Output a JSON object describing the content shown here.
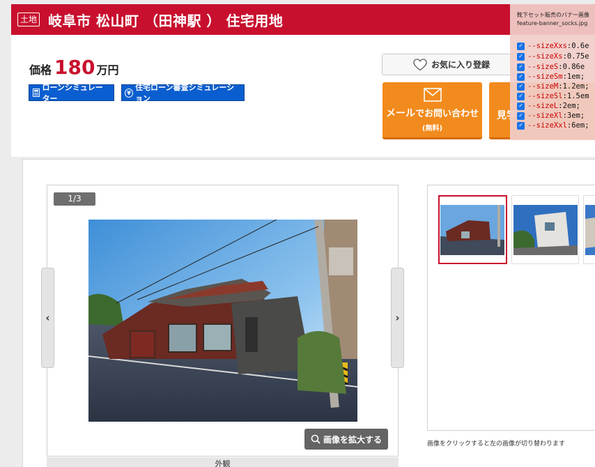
{
  "header": {
    "category_badge": "土地",
    "title": "岐阜市 松山町 （田神駅 ） 住宅用地"
  },
  "price": {
    "label": "価格",
    "value": "180",
    "unit": "万円"
  },
  "simulators": {
    "loan": "ローンシミュレーター",
    "review": "住宅ローン審査シミュレーション"
  },
  "actions": {
    "favorite": "お気に入り登録",
    "mail_big": "メール",
    "mail_rest": "でお問い合わせ",
    "mail_sub": "(無料)",
    "visit_partial": "見学"
  },
  "gallery": {
    "counter": "1/3",
    "prev_arrow": "‹",
    "next_arrow": "›",
    "zoom": "画像を拡大する",
    "caption": "外観",
    "thumb_note": "画像をクリックすると左の画像が切り替わります",
    "thumbnails": [
      {
        "name": "thumb-1",
        "active": true
      },
      {
        "name": "thumb-2",
        "active": false
      },
      {
        "name": "thumb-3",
        "active": false
      }
    ]
  },
  "devtools": {
    "header_line1": "靴下セット販売のバナー画像",
    "header_line2": "feature-banner_socks.jpg",
    "lines": [
      {
        "key": "--sizeXxs",
        "value": "0.6e"
      },
      {
        "key": "--sizeXs",
        "value": "0.75e"
      },
      {
        "key": "--sizeS",
        "value": "0.86e"
      },
      {
        "key": "--sizeSm",
        "value": "1em;"
      },
      {
        "key": "--sizeM",
        "value": "1.2em;"
      },
      {
        "key": "--sizeSl",
        "value": "1.5em"
      },
      {
        "key": "--sizeL",
        "value": "2em;"
      },
      {
        "key": "--sizeXl",
        "value": "3em;"
      },
      {
        "key": "--sizeXxl",
        "value": "6em;"
      }
    ]
  },
  "colors": {
    "brand_red": "#c8102e",
    "action_orange": "#f28b1d",
    "link_blue": "#0b5ecf"
  }
}
